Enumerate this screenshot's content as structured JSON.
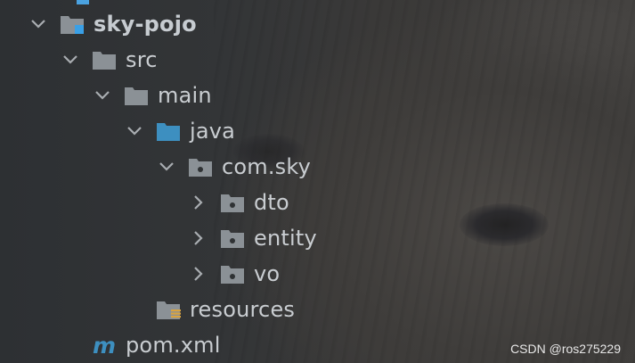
{
  "tree": {
    "items": [
      {
        "label": "sky-pojo",
        "expanded": true,
        "icon": "module-folder-icon"
      },
      {
        "label": "src",
        "expanded": true,
        "icon": "folder-icon"
      },
      {
        "label": "main",
        "expanded": true,
        "icon": "folder-icon"
      },
      {
        "label": "java",
        "expanded": true,
        "icon": "source-root-folder-icon"
      },
      {
        "label": "com.sky",
        "expanded": true,
        "icon": "package-icon"
      },
      {
        "label": "dto",
        "expanded": false,
        "icon": "package-icon"
      },
      {
        "label": "entity",
        "expanded": false,
        "icon": "package-icon"
      },
      {
        "label": "vo",
        "expanded": false,
        "icon": "package-icon"
      },
      {
        "label": "resources",
        "expanded": false,
        "icon": "resources-folder-icon"
      },
      {
        "label": "pom.xml",
        "expanded": false,
        "icon": "maven-icon"
      }
    ]
  },
  "watermark": {
    "text": "CSDN @ros275229"
  },
  "colors": {
    "folder": "#8b9196",
    "source_root": "#3d8fc0",
    "module_badge": "#3aa0e6",
    "maven": "#3d8fc0",
    "resources_badge": "#d9a441"
  }
}
